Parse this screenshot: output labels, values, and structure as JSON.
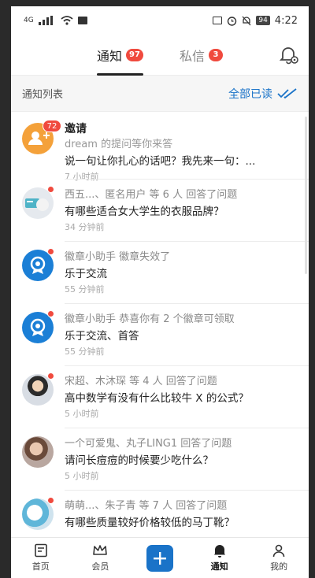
{
  "status_bar": {
    "network": "4G",
    "time": "4:22",
    "battery": "94"
  },
  "tabs": [
    {
      "label": "通知",
      "badge": "97"
    },
    {
      "label": "私信",
      "badge": "3"
    }
  ],
  "list_header": {
    "title": "通知列表",
    "mark_all_read": "全部已读"
  },
  "notifications": [
    {
      "title": "邀请",
      "subtitle": "dream 的提问等你来答",
      "content": "说一句让你扎心的话吧？我先来一句：...",
      "time": "7 小时前",
      "count": "72"
    },
    {
      "title": "西五...、匿名用户 等 6 人 回答了问题",
      "content": "有哪些适合女大学生的衣服品牌？",
      "time": "34 分钟前"
    },
    {
      "title": "徽章小助手 徽章失效了",
      "content": "乐于交流",
      "time": "55 分钟前"
    },
    {
      "title": "徽章小助手 恭喜你有 2 个徽章可领取",
      "content": "乐于交流、首答",
      "time": "55 分钟前"
    },
    {
      "title": "宋超、木沐琛 等 4 人 回答了问题",
      "content": "高中数学有没有什么比较牛 X 的公式？",
      "time": "5 小时前"
    },
    {
      "title": "一个可爱鬼、丸子LING1 回答了问题",
      "content": "请问长痘痘的时候要少吃什么？",
      "time": "5 小时前"
    },
    {
      "title": "萌萌...、朱子青 等 7 人 回答了问题",
      "content": "有哪些质量较好价格较低的马丁靴？",
      "time": ""
    }
  ],
  "bottom_nav": {
    "home": "首页",
    "vip": "会员",
    "notify": "通知",
    "me": "我的"
  },
  "colors": {
    "accent": "#1a73c8",
    "badge": "#f04a3e"
  }
}
